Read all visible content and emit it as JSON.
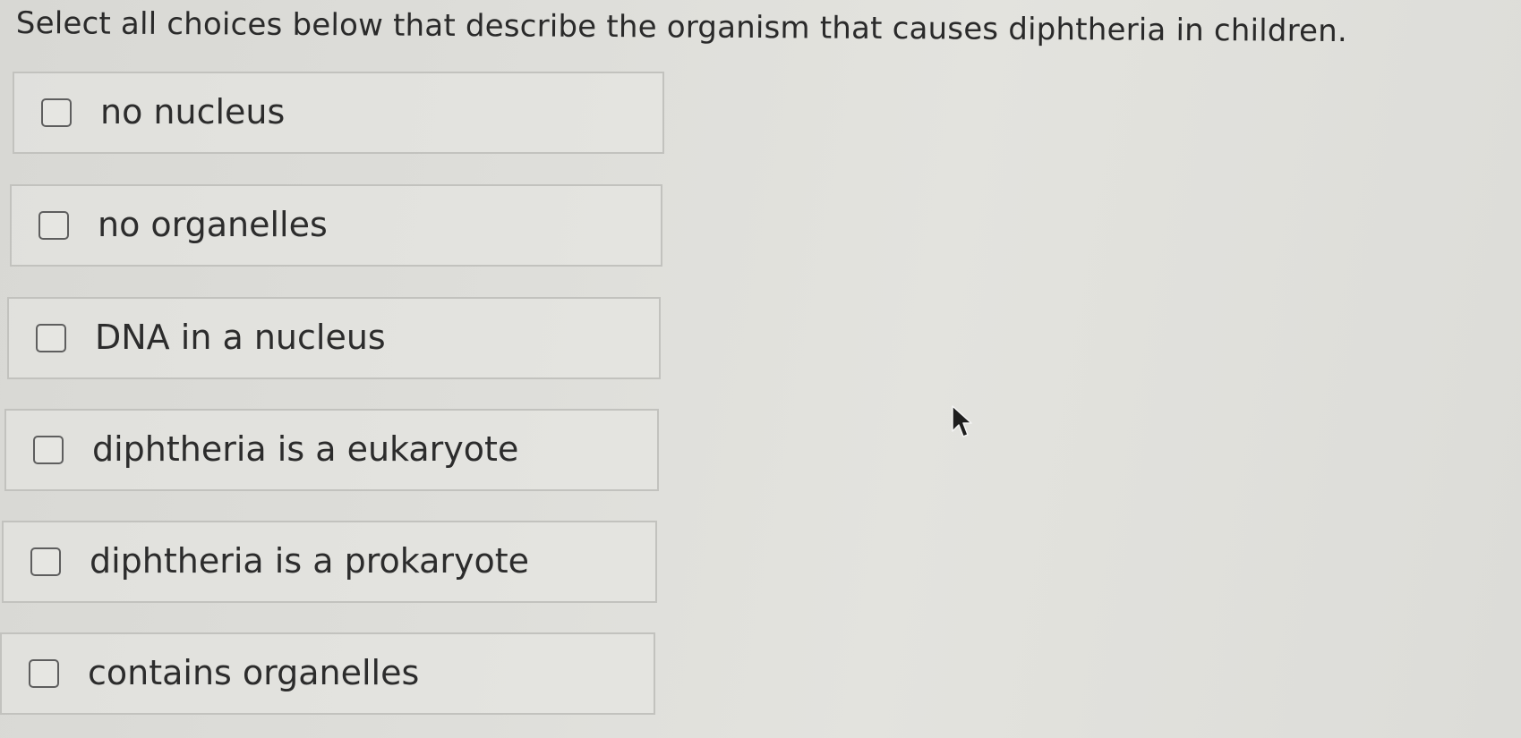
{
  "question": "Select all choices below that describe the organism that causes diphtheria in children.",
  "options": [
    {
      "label": "no nucleus",
      "checked": false
    },
    {
      "label": "no organelles",
      "checked": false
    },
    {
      "label": "DNA in a nucleus",
      "checked": false
    },
    {
      "label": "diphtheria is a eukaryote",
      "checked": false
    },
    {
      "label": "diphtheria is a prokaryote",
      "checked": false
    },
    {
      "label": "contains organelles",
      "checked": false
    }
  ],
  "icons": {
    "checkbox": "empty-checkbox-icon",
    "cursor": "mouse-pointer-icon"
  }
}
